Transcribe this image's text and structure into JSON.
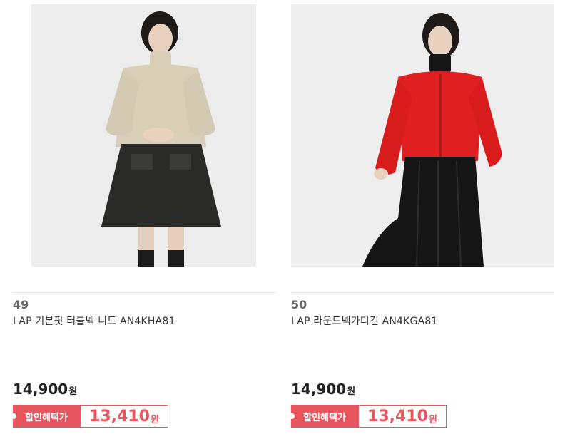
{
  "products": [
    {
      "rank": "49",
      "name": "LAP 기본핏 터틀넥 니트 AN4KHA81",
      "price": "14,900",
      "price_unit": "원",
      "discount_label": "할인혜택가",
      "discount_price": "13,410",
      "discount_unit": "원",
      "photo_alt": "model in beige turtleneck knit and black skirt"
    },
    {
      "rank": "50",
      "name": "LAP 라운드넥가디건 AN4KGA81",
      "price": "14,900",
      "price_unit": "원",
      "discount_label": "할인혜택가",
      "discount_price": "13,410",
      "discount_unit": "원",
      "photo_alt": "model in red round-neck cardigan and black pleated skirt"
    }
  ],
  "colors": {
    "accent": "#e8555c",
    "text": "#333333",
    "rank": "#666666"
  }
}
